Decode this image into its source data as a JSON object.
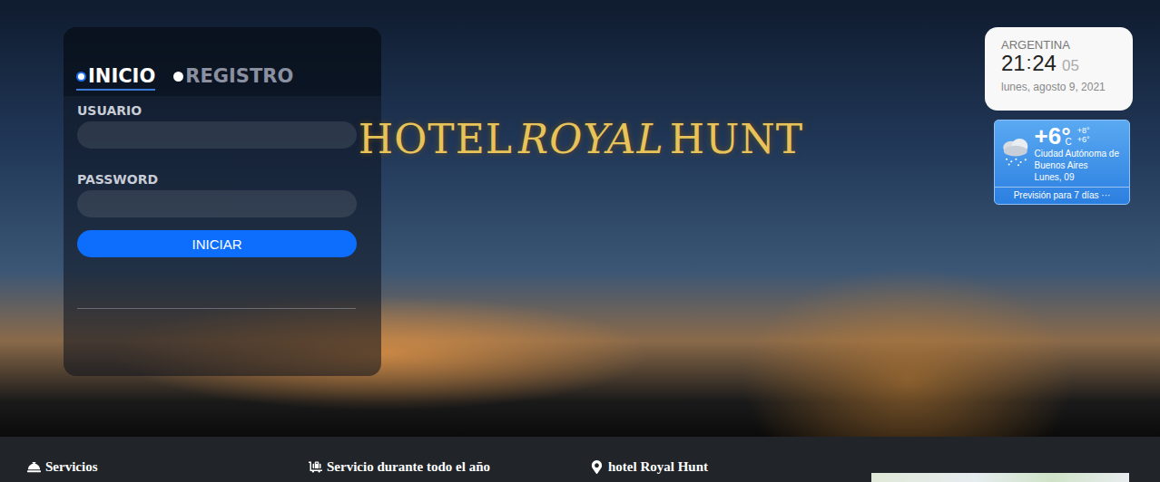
{
  "brand": {
    "parts": [
      "HOTEL",
      "ROYAL",
      "HUNT"
    ]
  },
  "login": {
    "tabs": [
      {
        "label": "INICIO",
        "selected": true
      },
      {
        "label": "REGISTRO",
        "selected": false
      }
    ],
    "fields": [
      {
        "label": "USUARIO",
        "value": ""
      },
      {
        "label": "PASSWORD",
        "value": ""
      }
    ],
    "button": "INICIAR"
  },
  "clock": {
    "country": "ARGENTINA",
    "hours": "21",
    "separator": ":",
    "minutes": "24",
    "seconds": "05",
    "date": "lunes, agosto 9, 2021"
  },
  "weather": {
    "temperature": "+6°",
    "unit": "C",
    "high": "+8°",
    "low": "+6°",
    "city": "Ciudad Autónoma de Buenos Aires",
    "day": "Lunes, 09",
    "forecast_link": "Previsión para 7 días",
    "more": "···"
  },
  "footer": {
    "items": [
      {
        "label": "Servicios",
        "kind": "bell"
      },
      {
        "label": "Servicio durante todo el año",
        "kind": "cart"
      },
      {
        "label": "hotel Royal Hunt",
        "kind": "pin"
      }
    ]
  }
}
